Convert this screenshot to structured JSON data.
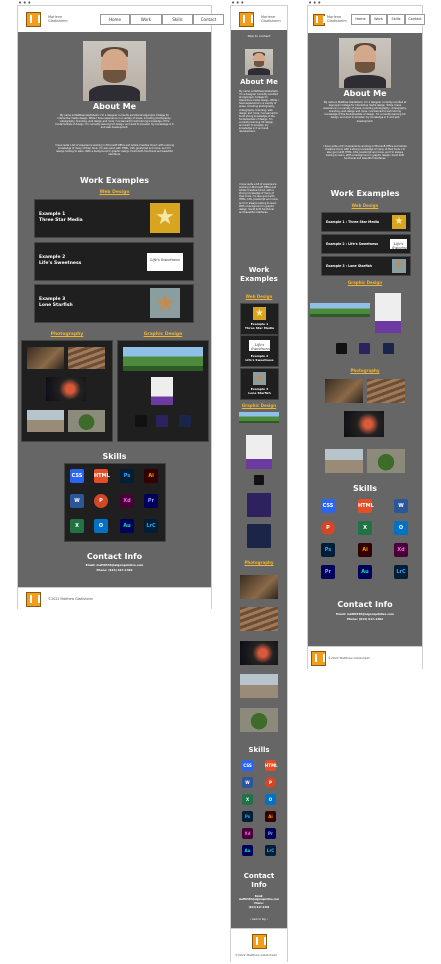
{
  "window_dots": "•••",
  "brand": {
    "line1": "Marlene",
    "line2": "Gladisheim"
  },
  "nav": [
    "Home",
    "Work",
    "Skills",
    "Contact"
  ],
  "skip_link": "Skip to content",
  "about": {
    "title": "About Me",
    "para1": "My name is Matthew Gladisheim. I'm a designer currently enrolled at Algonquin College for Interactive media design. While I have experience in a variety of areas, including photography, videography, branding, web design and more, I've learned to build strong knowledge of the fundamentals of design. I'm currently learning UX design, and want to broaden my knowledge in it and web development.",
    "para2": "I have quite a bit of experience working in Microsoft Office and Adobe Creative Cloud, with a strong knowledge of many of their tools. I'm also good with HTML, CSS, JavaScript and more, and I'm always looking to learn. With a background in graphic design I build both functional and beautiful interfaces."
  },
  "work": {
    "title": "Work Examples",
    "web_design": "Web Design",
    "examples": [
      {
        "label": "Example 1",
        "name": "Three Star Media",
        "inline": "Example 1 : Three Star Media"
      },
      {
        "label": "Example 2",
        "name": "Life's Sweetness",
        "inline": "Example 2 : Life's Sweetness"
      },
      {
        "label": "Example 3",
        "name": "Lone Starfish",
        "inline": "Example 3 : Lone Starfish"
      }
    ],
    "photography": "Photography",
    "graphic_design": "Graphic Design"
  },
  "skills": {
    "title": "Skills",
    "items": [
      "CSS",
      "HTML",
      "Ps",
      "Ai",
      "W",
      "P",
      "Xd",
      "Pr",
      "X",
      "O",
      "Au",
      "LrC"
    ]
  },
  "contact": {
    "title": "Contact Info",
    "email": "Email: matt0336@algonquinlive.com",
    "phone": "Phone: (613) 617-1302",
    "email_label": "Email:",
    "email_value": "matt0336@algonquinlive.com",
    "phone_label": "Phone:",
    "phone_value": "(613) 617-1302",
    "back_to_top": "• back to top •"
  },
  "footer": {
    "copyright": "©2022 Matthew Gladisheim"
  },
  "colors": {
    "accent_orange": "#f29d1b",
    "panel_gray": "#666666",
    "dark_card": "#1f1f1f"
  }
}
